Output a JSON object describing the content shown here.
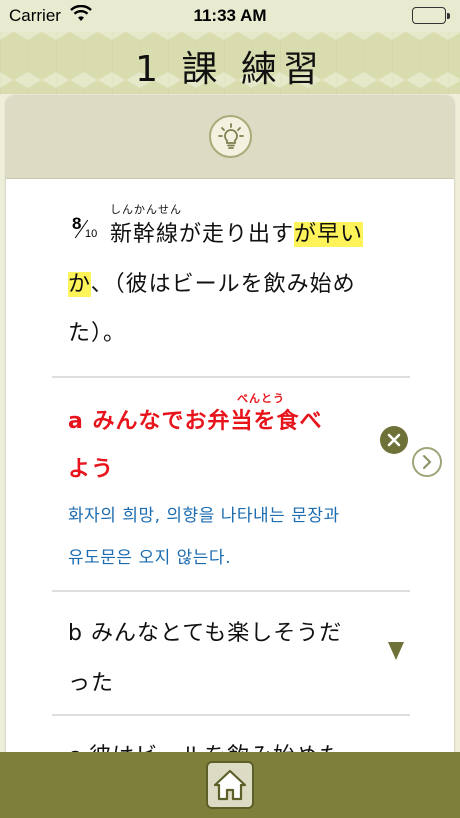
{
  "status_bar": {
    "carrier": "Carrier",
    "time": "11:33 AM"
  },
  "header": {
    "title": "1 課 練習"
  },
  "hint": {
    "icon": "lightbulb-icon"
  },
  "question": {
    "number": "8",
    "total": "10",
    "ruby_shinkansen": "しんかんせん",
    "line1_pre": "新幹線が走り出す",
    "line1_hl": "が早い",
    "line2_hl": "か",
    "line2_post": "、（彼はビールを飲み始め",
    "line3": "た）。"
  },
  "options": [
    {
      "label": "a",
      "ruby": "べんとう",
      "text_line1": "a みんなでお弁当を食べ",
      "text_line2": "よう",
      "status": "incorrect",
      "explanation_line1": "화자의 희망, 의향을 나타내는 문장과",
      "explanation_line2": "유도문은 오지 않는다."
    },
    {
      "label": "b",
      "text_line1": "b みんなとても楽しそうだ",
      "text_line2": "った"
    },
    {
      "label": "c",
      "text_line1": "c 彼はビールを飲み始めた"
    }
  ],
  "colors": {
    "accent_olive": "#7d7f3b",
    "highlight": "#fff35a",
    "wrong_red": "#e8141b",
    "explain_blue": "#1c6cb0"
  },
  "bottom_bar": {
    "icon": "home-icon"
  }
}
